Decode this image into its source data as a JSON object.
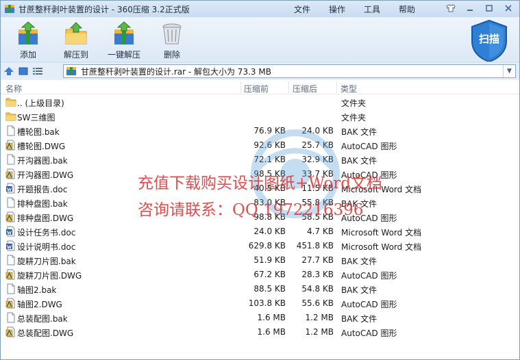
{
  "window": {
    "title": "甘蔗整秆剥叶装置的设计 - 360压缩 3.2正式版"
  },
  "menu": [
    "文件",
    "操作",
    "工具",
    "帮助"
  ],
  "toolbar": {
    "add": "添加",
    "extract_to": "解压到",
    "one_click_extract": "一键解压",
    "delete": "删除",
    "scan": "扫描"
  },
  "address": {
    "path": "甘蔗整秆剥叶装置的设计.rar - 解包大小为 73.3 MB"
  },
  "columns": {
    "name": "名称",
    "size": "压缩前",
    "packed": "压缩后",
    "type": "类型"
  },
  "files": [
    {
      "name": ".. (上级目录)",
      "size": "",
      "packed": "",
      "type": "文件夹",
      "icon": "folder-icon"
    },
    {
      "name": "SW三维图",
      "size": "",
      "packed": "",
      "type": "文件夹",
      "icon": "folder-icon"
    },
    {
      "name": "槽轮图.bak",
      "size": "76.9 KB",
      "packed": "24.0 KB",
      "type": "BAK 文件",
      "icon": "file-icon"
    },
    {
      "name": "槽轮图.DWG",
      "size": "92.6 KB",
      "packed": "25.7 KB",
      "type": "AutoCAD 图形",
      "icon": "dwg-icon"
    },
    {
      "name": "开沟器图.bak",
      "size": "72.1 KB",
      "packed": "32.9 KB",
      "type": "BAK 文件",
      "icon": "file-icon"
    },
    {
      "name": "开沟器图.DWG",
      "size": "98.5 KB",
      "packed": "33.7 KB",
      "type": "AutoCAD 图形",
      "icon": "dwg-icon"
    },
    {
      "name": "开题报告.doc",
      "size": "40.5 KB",
      "packed": "11.5 KB",
      "type": "Microsoft Word 文档",
      "icon": "doc-icon"
    },
    {
      "name": "排种盘图.bak",
      "size": "83.0 KB",
      "packed": "55.8 KB",
      "type": "BAK 文件",
      "icon": "file-icon"
    },
    {
      "name": "排种盘图.DWG",
      "size": "98.8 KB",
      "packed": "58.5 KB",
      "type": "AutoCAD 图形",
      "icon": "dwg-icon"
    },
    {
      "name": "设计任务书.doc",
      "size": "24.0 KB",
      "packed": "4.7 KB",
      "type": "Microsoft Word 文档",
      "icon": "doc-icon"
    },
    {
      "name": "设计说明书.doc",
      "size": "629.8 KB",
      "packed": "451.8 KB",
      "type": "Microsoft Word 文档",
      "icon": "doc-icon"
    },
    {
      "name": "旋耕刀片图.bak",
      "size": "51.9 KB",
      "packed": "27.7 KB",
      "type": "BAK 文件",
      "icon": "file-icon"
    },
    {
      "name": "旋耕刀片图.DWG",
      "size": "67.2 KB",
      "packed": "28.3 KB",
      "type": "AutoCAD 图形",
      "icon": "dwg-icon"
    },
    {
      "name": "轴图2.bak",
      "size": "88.5 KB",
      "packed": "54.8 KB",
      "type": "BAK 文件",
      "icon": "file-icon"
    },
    {
      "name": "轴图2.DWG",
      "size": "103.8 KB",
      "packed": "55.6 KB",
      "type": "AutoCAD 图形",
      "icon": "dwg-icon"
    },
    {
      "name": "总装配图.bak",
      "size": "1.6 MB",
      "packed": "1.2 MB",
      "type": "BAK 文件",
      "icon": "file-icon"
    },
    {
      "name": "总装配图.DWG",
      "size": "1.6 MB",
      "packed": "1.2 MB",
      "type": "AutoCAD 图形",
      "icon": "dwg-icon"
    }
  ],
  "watermark": {
    "line1": "充值下载购买设计图纸+Word文档",
    "line2": "咨询请联系：QQ 1972216396"
  }
}
